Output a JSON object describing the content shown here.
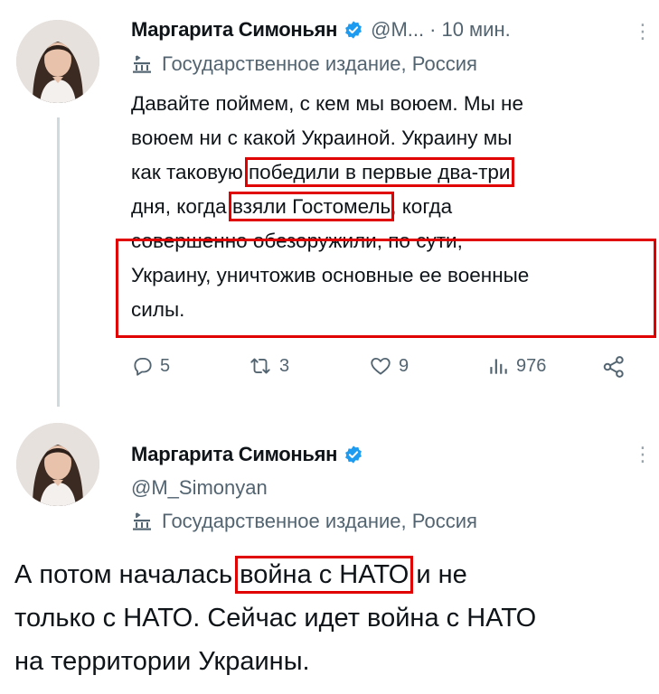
{
  "tweet1": {
    "author_name": "Маргарита Симоньян",
    "handle": "@M...",
    "separator": "·",
    "time": "10 мин.",
    "more": "⋮",
    "label": "Государственное издание, Россия",
    "text_lines": [
      {
        "before": "Давайте поймем, с кем мы воюем. Мы не",
        "mark": "",
        "after": ""
      },
      {
        "before": "воюем ни с какой Украиной. Украину мы",
        "mark": "",
        "after": ""
      },
      {
        "before": "как таковую ",
        "mark": "победили в первые два-три",
        "after": ""
      },
      {
        "before": "дня, когда ",
        "mark": "взяли Гостомель",
        "after": ", когда"
      },
      {
        "before": "совершенно обезоружили, по сути,",
        "mark": "",
        "after": ""
      },
      {
        "before": "Украину, уничтожив основные ее военные",
        "mark": "",
        "after": ""
      },
      {
        "before": "силы.",
        "mark": "",
        "after": ""
      }
    ],
    "stats": {
      "replies": "5",
      "retweets": "3",
      "likes": "9",
      "views": "976"
    }
  },
  "tweet2": {
    "author_name": "Маргарита Симоньян",
    "handle": "@M_Simonyan",
    "more": "⋮",
    "label": "Государственное издание, Россия",
    "text_lines": [
      {
        "before": "А потом началась ",
        "mark": "война с НАТО",
        "after": " и не"
      },
      {
        "before": "только с НАТО. Сейчас идет война с НАТО",
        "mark": "",
        "after": ""
      },
      {
        "before": "на территории Украины.",
        "mark": "",
        "after": ""
      }
    ]
  },
  "colors": {
    "highlight": "#e00000",
    "verified": "#1d9bf0",
    "muted": "#536471",
    "text": "#0f1419"
  },
  "icons": [
    "verified-badge-icon",
    "government-building-icon",
    "reply-icon",
    "retweet-icon",
    "like-icon",
    "views-icon",
    "share-icon",
    "more-icon"
  ]
}
